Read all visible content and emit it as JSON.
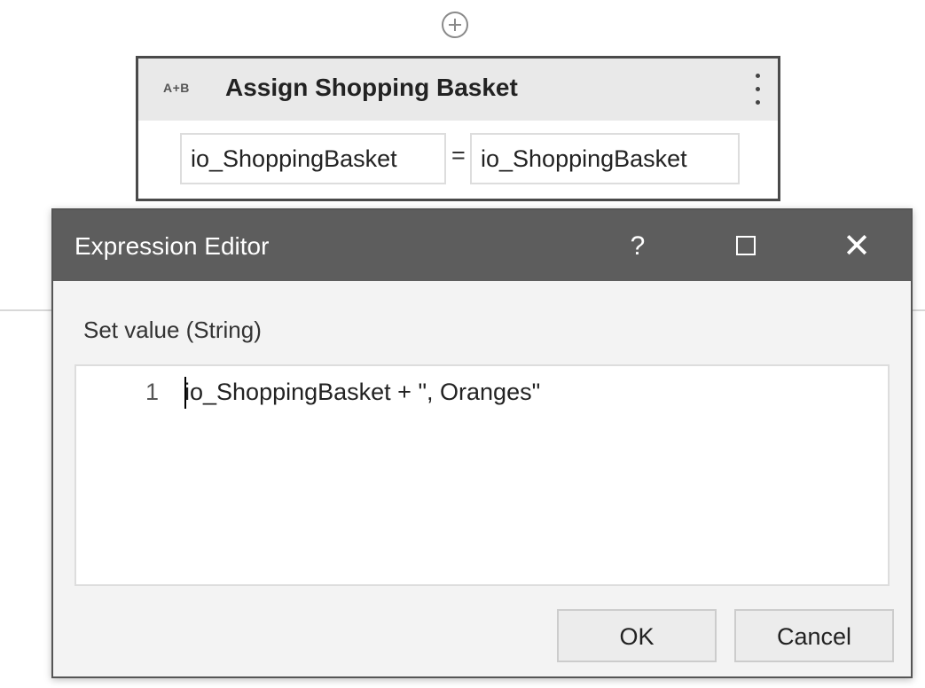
{
  "designer": {
    "add_icon": "plus-circle-icon"
  },
  "assign_activity": {
    "icon_text": "A+B",
    "title": "Assign Shopping Basket",
    "menu_icon": "kebab-menu-icon",
    "to_value": "io_ShoppingBasket",
    "equals": "=",
    "value_value": "io_ShoppingBasket"
  },
  "expression_editor": {
    "title": "Expression Editor",
    "help_label": "?",
    "maximize_icon": "maximize-icon",
    "close_label": "✕",
    "set_value_label": "Set value (String)",
    "lines": [
      {
        "number": "1",
        "code": "io_ShoppingBasket + \", Oranges\""
      }
    ],
    "ok_label": "OK",
    "cancel_label": "Cancel"
  }
}
